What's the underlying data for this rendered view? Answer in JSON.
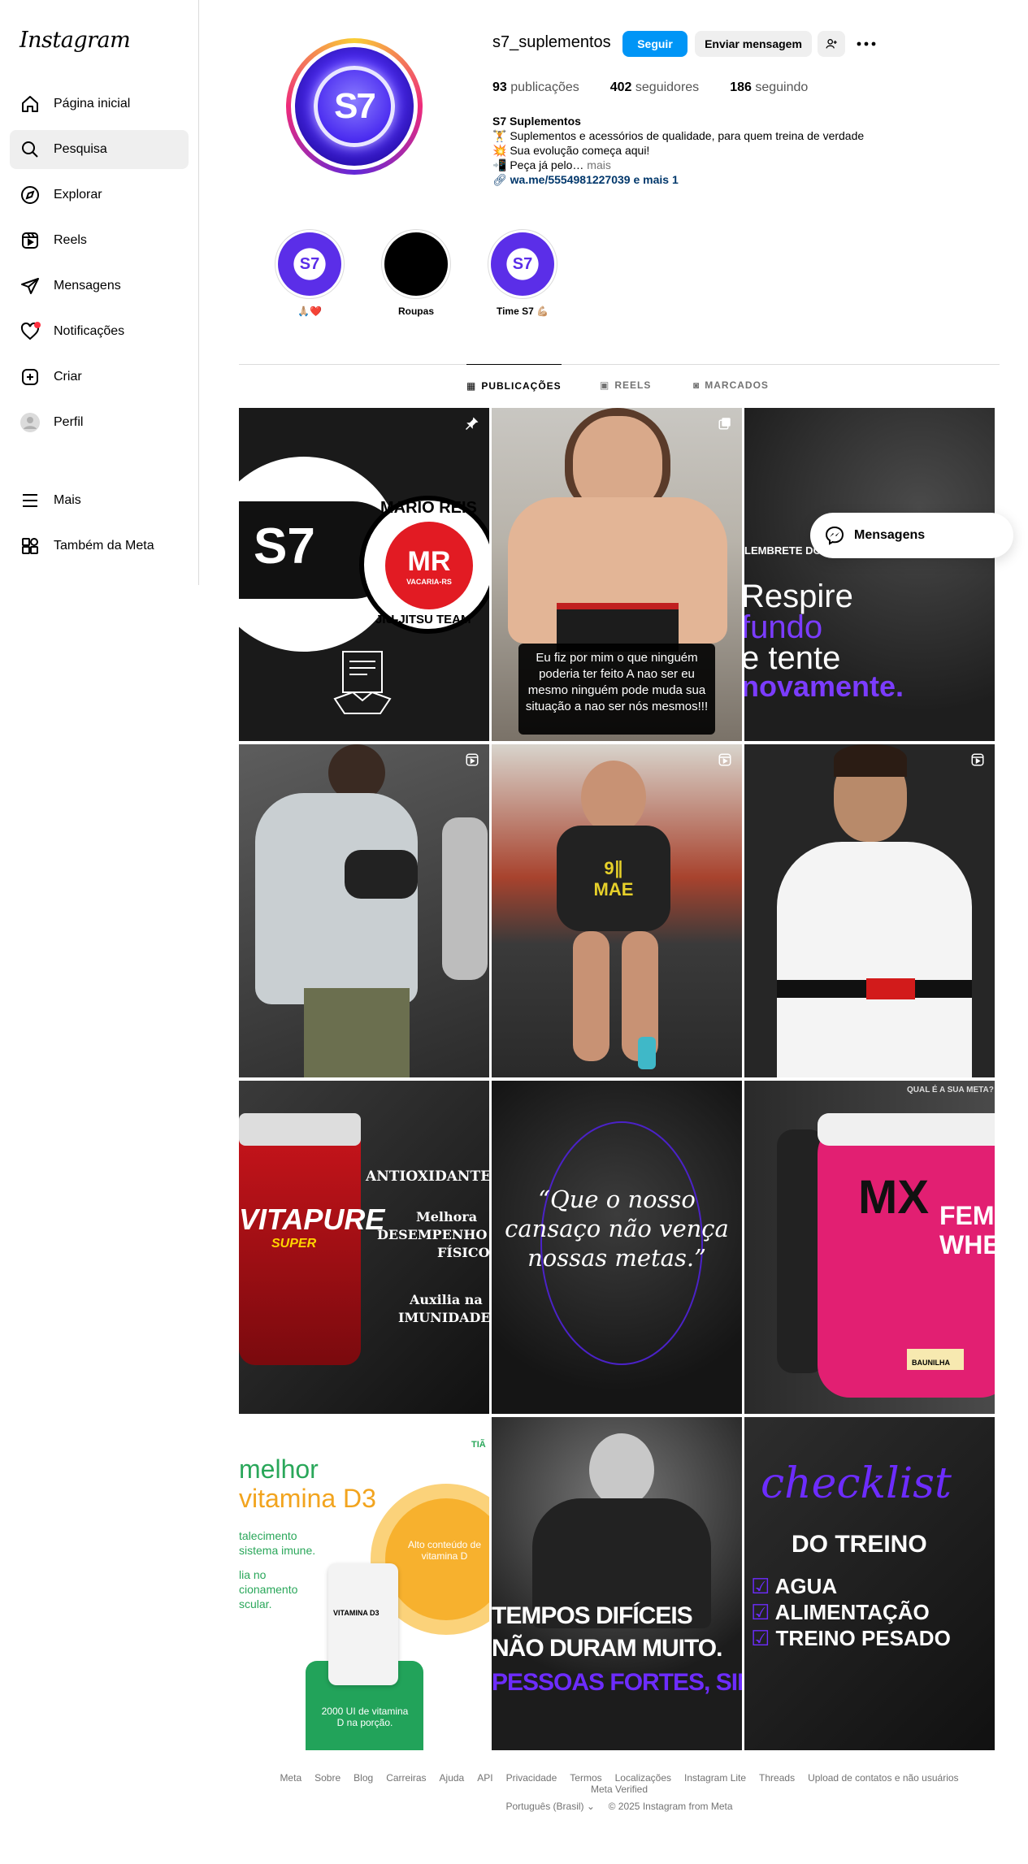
{
  "app": {
    "logo": "Instagram"
  },
  "sidebar": {
    "items": [
      {
        "label": "Página inicial",
        "icon": "home-icon"
      },
      {
        "label": "Pesquisa",
        "icon": "search-icon"
      },
      {
        "label": "Explorar",
        "icon": "compass-icon"
      },
      {
        "label": "Reels",
        "icon": "reels-icon"
      },
      {
        "label": "Mensagens",
        "icon": "send-icon"
      },
      {
        "label": "Notificações",
        "icon": "heart-icon"
      },
      {
        "label": "Criar",
        "icon": "plus-square-icon"
      },
      {
        "label": "Perfil",
        "icon": "profile-avatar-icon"
      },
      {
        "label": "Mais",
        "icon": "menu-icon"
      },
      {
        "label": "Também da Meta",
        "icon": "meta-apps-icon"
      }
    ]
  },
  "profile": {
    "username": "s7_suplementos",
    "avatar_text": "S7",
    "follow_label": "Seguir",
    "message_label": "Enviar mensagem",
    "stats": {
      "posts_count": "93",
      "posts_label": "publicações",
      "followers_count": "402",
      "followers_label": "seguidores",
      "following_count": "186",
      "following_label": "seguindo"
    },
    "bio": {
      "name": "S7 Suplementos",
      "line1": "🏋️ Suplementos e acessórios de qualidade, para quem treina de verdade",
      "line2": "💥 Sua evolução começa aqui!",
      "line3": "📲 Peça já pelo…",
      "more": " mais",
      "link": "wa.me/5554981227039 e mais 1"
    }
  },
  "highlights": [
    {
      "label": "🙏🏼❤️",
      "text": "S7"
    },
    {
      "label": "Roupas",
      "text": ""
    },
    {
      "label": "Time S7 💪🏼",
      "text": "S7"
    }
  ],
  "tabs": [
    {
      "label": "PUBLICAÇÕES",
      "active": true
    },
    {
      "label": "REELS",
      "active": false
    },
    {
      "label": "MARCADOS",
      "active": false
    }
  ],
  "posts": {
    "p1": {
      "s7": "S7",
      "line1": "MARIO REIS",
      "mr": "MR",
      "city": "VACARIA-RS",
      "line2": "JIU-JITSU TEAM"
    },
    "p2": {
      "caption": "Eu fiz por mim o que ninguém poderia ter feito A nao ser eu mesmo ninguém pode muda sua situação a nao ser nós mesmos!!!"
    },
    "p3": {
      "title": "LEMBRETE DO DIA:",
      "l1": "Respire",
      "l2": "fundo",
      "l3": "e tente",
      "l4": "novamente."
    },
    "p5": {
      "shirt": "9∥ MAE"
    },
    "p7": {
      "brand": "VITAPURE",
      "sub": "SUPER",
      "t1": "ANTIOXIDANTE",
      "t2": "Melhora",
      "t3": "DESEMPENHO",
      "t4": "FÍSICO",
      "t5": "Auxilia na",
      "t6": "IMUNIDADE"
    },
    "p8": {
      "quote": "“Que o nosso cansaço não vença nossas metas.”"
    },
    "p9": {
      "top": "QUAL É A SUA META?",
      "brand": "MX",
      "name": "FEMME WHEY",
      "flavor": "BAUNILHA"
    },
    "p10": {
      "h1": "melhor",
      "h2": "vitamina D3",
      "b1": "talecimento",
      "b2": "sistema imune.",
      "b3": "lia no",
      "b4": "cionamento",
      "b5": "scular.",
      "sun": "Alto conteúdo de vitamina D",
      "bottle": "VITAMINA D3",
      "dose": "2000 UI de vitamina D na porção.",
      "brand": "TIÃ"
    },
    "p11": {
      "l1": "TEMPOS DIFÍCEIS",
      "l2": "NÃO DURAM MUITO.",
      "l3": "PESSOAS FORTES, SIM"
    },
    "p12": {
      "script": "checklist",
      "title": "DO TREINO",
      "i1": "AGUA",
      "i2": "ALIMENTAÇÃO",
      "i3": "TREINO PESADO"
    }
  },
  "floating": {
    "messages_label": "Mensagens"
  },
  "footer": {
    "links": [
      "Meta",
      "Sobre",
      "Blog",
      "Carreiras",
      "Ajuda",
      "API",
      "Privacidade",
      "Termos",
      "Localizações",
      "Instagram Lite",
      "Threads",
      "Upload de contatos e não usuários",
      "Meta Verified"
    ],
    "language": "Português (Brasil)",
    "copyright": "© 2025 Instagram from Meta"
  }
}
